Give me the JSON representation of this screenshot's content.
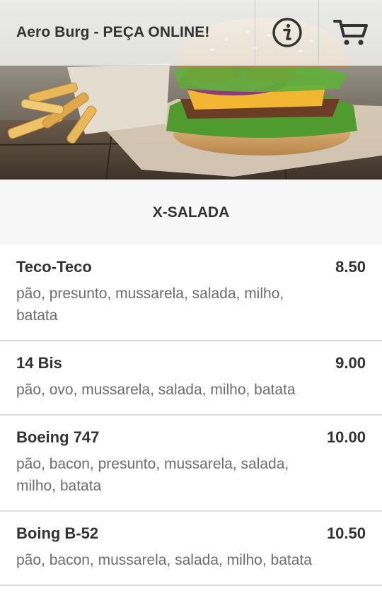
{
  "header": {
    "title": "Aero Burg - PEÇA ONLINE!",
    "info_icon": "info-icon",
    "cart_icon": "cart-icon"
  },
  "hero": {
    "image_icon": "burger-and-fries-photo"
  },
  "category": {
    "title": "X-SALADA"
  },
  "items": [
    {
      "name": "Teco-Teco",
      "price": "8.50",
      "description": "pão, presunto, mussarela, salada, milho, batata"
    },
    {
      "name": "14 Bis",
      "price": "9.00",
      "description": "pão, ovo, mussarela, salada, milho, batata"
    },
    {
      "name": "Boeing 747",
      "price": "10.00",
      "description": "pão, bacon, presunto, mussarela, salada, milho, batata"
    },
    {
      "name": "Boing B-52",
      "price": "10.50",
      "description": "pão, bacon, mussarela, salada, milho, batata"
    }
  ],
  "colors": {
    "text": "#333333",
    "muted_text": "#6d6d6d",
    "category_bg": "#f7f7f7",
    "divider": "#dddddd"
  }
}
